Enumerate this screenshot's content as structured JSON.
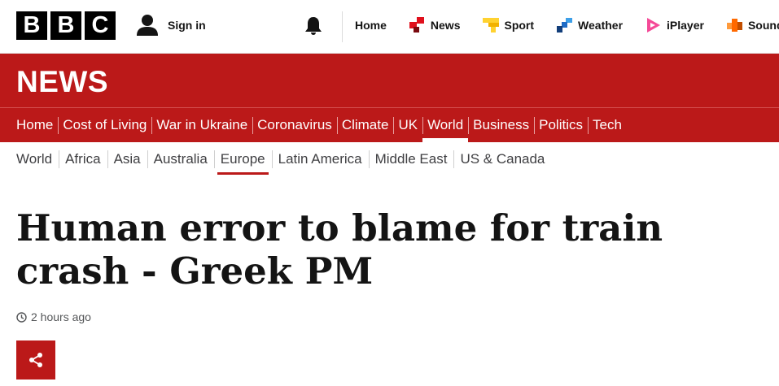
{
  "header": {
    "logo_letters": [
      "B",
      "B",
      "C"
    ],
    "signin_label": "Sign in",
    "nav": [
      {
        "label": "Home",
        "icon": "none"
      },
      {
        "label": "News",
        "icon": "news-icon",
        "color": "#e0101c"
      },
      {
        "label": "Sport",
        "icon": "sport-icon",
        "color": "#ffd230"
      },
      {
        "label": "Weather",
        "icon": "weather-icon",
        "color": "#1e6cc7"
      },
      {
        "label": "iPlayer",
        "icon": "iplayer-icon",
        "color": "#f54997"
      },
      {
        "label": "Sounds",
        "icon": "sounds-icon",
        "color": "#ff6900"
      }
    ]
  },
  "banner": {
    "title": "NEWS",
    "color": "#bb1919"
  },
  "main_nav": {
    "items": [
      "Home",
      "Cost of Living",
      "War in Ukraine",
      "Coronavirus",
      "Climate",
      "UK",
      "World",
      "Business",
      "Politics",
      "Tech"
    ],
    "active": "World"
  },
  "sub_nav": {
    "items": [
      "World",
      "Africa",
      "Asia",
      "Australia",
      "Europe",
      "Latin America",
      "Middle East",
      "US & Canada"
    ],
    "active": "Europe"
  },
  "article": {
    "headline": "Human error to blame for train crash - Greek PM",
    "timestamp": "2 hours ago"
  },
  "share": {
    "icon": "share-icon"
  }
}
